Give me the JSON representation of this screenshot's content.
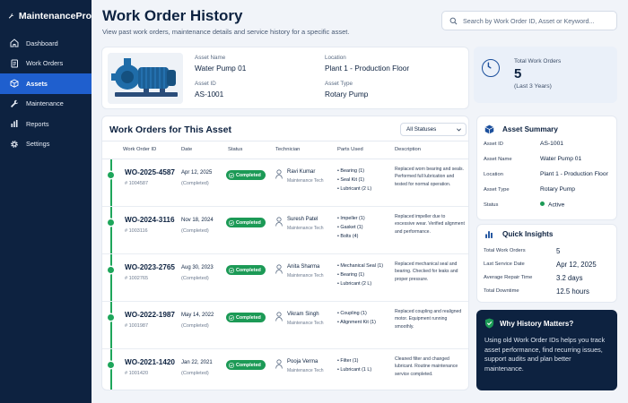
{
  "app": {
    "name": "MaintenancePro"
  },
  "sidebar": {
    "items": [
      {
        "label": "Dashboard",
        "icon": "dashboard-icon",
        "active": false
      },
      {
        "label": "Work Orders",
        "icon": "document-icon",
        "active": false
      },
      {
        "label": "Assets",
        "icon": "cube-icon",
        "active": true
      },
      {
        "label": "Maintenance",
        "icon": "wrench-icon",
        "active": false
      },
      {
        "label": "Reports",
        "icon": "bar-chart-icon",
        "active": false
      },
      {
        "label": "Settings",
        "icon": "gear-icon",
        "active": false
      }
    ]
  },
  "header": {
    "title": "Work Order History",
    "subtitle": "View past work orders, maintenance details and service history for a specific asset."
  },
  "search": {
    "placeholder": "Search by Work Order ID, Asset or Keyword..."
  },
  "asset": {
    "name_label": "Asset Name",
    "name": "Water Pump 01",
    "id_label": "Asset ID",
    "id": "AS-1001",
    "location_label": "Location",
    "location": "Plant 1 - Production Floor",
    "type_label": "Asset Type",
    "type": "Rotary Pump"
  },
  "total_work_orders": {
    "label": "Total Work Orders",
    "value": "5",
    "sub": "(Last 3 Years)"
  },
  "work_orders": {
    "title": "Work Orders for This Asset",
    "filter_value": "All Statuses",
    "columns": [
      "Work Order ID",
      "Date",
      "Status",
      "Technician",
      "Parts Used",
      "Description"
    ],
    "rows": [
      {
        "id": "WO-2025-4587",
        "num": "# 1004587",
        "date": "Apr 12, 2025",
        "date_sub": "(Completed)",
        "status": "Completed",
        "tech": "Ravi Kumar",
        "role": "Maintenance Tech",
        "parts": [
          "Bearing (1)",
          "Seal Kit (1)",
          "Lubricant (2 L)"
        ],
        "desc": "Replaced worn bearing and seals. Performed full lubrication and tested for normal operation."
      },
      {
        "id": "WO-2024-3116",
        "num": "# 1003116",
        "date": "Nov 18, 2024",
        "date_sub": "(Completed)",
        "status": "Completed",
        "tech": "Suresh Patel",
        "role": "Maintenance Tech",
        "parts": [
          "Impeller (1)",
          "Gasket (1)",
          "Bolts (4)"
        ],
        "desc": "Replaced impeller due to excessive wear. Verified alignment and performance."
      },
      {
        "id": "WO-2023-2765",
        "num": "# 1002765",
        "date": "Aug 30, 2023",
        "date_sub": "(Completed)",
        "status": "Completed",
        "tech": "Anita Sharma",
        "role": "Maintenance Tech",
        "parts": [
          "Mechanical Seal (1)",
          "Bearing (1)",
          "Lubricant (2 L)"
        ],
        "desc": "Replaced mechanical seal and bearing. Checked for leaks and proper pressure."
      },
      {
        "id": "WO-2022-1987",
        "num": "# 1001987",
        "date": "May 14, 2022",
        "date_sub": "(Completed)",
        "status": "Completed",
        "tech": "Vikram Singh",
        "role": "Maintenance Tech",
        "parts": [
          "Coupling (1)",
          "Alignment Kit (1)"
        ],
        "desc": "Replaced coupling and realigned motor. Equipment running smoothly."
      },
      {
        "id": "WO-2021-1420",
        "num": "# 1001420",
        "date": "Jan 22, 2021",
        "date_sub": "(Completed)",
        "status": "Completed",
        "tech": "Pooja Verma",
        "role": "Maintenance Tech",
        "parts": [
          "Filter (1)",
          "Lubricant (1 L)"
        ],
        "desc": "Cleaned filter and changed lubricant. Routine maintenance service completed."
      }
    ]
  },
  "asset_summary": {
    "title": "Asset Summary",
    "items": [
      {
        "label": "Asset ID",
        "value": "AS-1001"
      },
      {
        "label": "Asset Name",
        "value": "Water Pump 01"
      },
      {
        "label": "Location",
        "value": "Plant 1 - Production Floor"
      },
      {
        "label": "Asset Type",
        "value": "Rotary Pump"
      },
      {
        "label": "Status",
        "value": "Active"
      }
    ]
  },
  "quick_insights": {
    "title": "Quick Insights",
    "items": [
      {
        "label": "Total Work Orders",
        "value": "5"
      },
      {
        "label": "Last Service Date",
        "value": "Apr 12, 2025"
      },
      {
        "label": "Average Repair Time",
        "value": "3.2 days"
      },
      {
        "label": "Total Downtime",
        "value": "12.5 hours"
      }
    ]
  },
  "why_history": {
    "title": "Why History Matters?",
    "text": "Using old Work Order IDs helps you track asset performance, find recurring issues, support audits and plan better maintenance."
  },
  "colors": {
    "sidebar": "#0d2240",
    "active": "#1f5fce",
    "success": "#1c9a56",
    "accent": "#1b4f9c"
  }
}
